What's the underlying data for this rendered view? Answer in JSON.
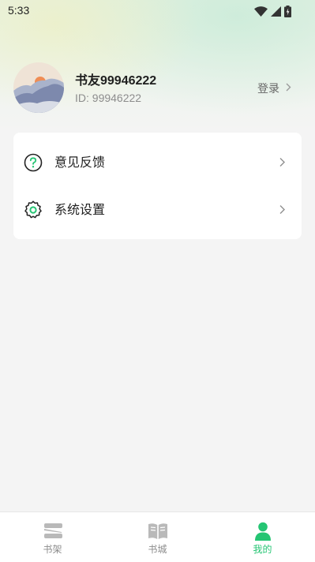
{
  "status_bar": {
    "time": "5:33",
    "icons": [
      "wifi-icon",
      "signal-icon",
      "battery-icon"
    ]
  },
  "profile": {
    "avatar": "mountain-sun-avatar",
    "name": "书友99946222",
    "id_label": "ID: 99946222",
    "login_label": "登录"
  },
  "menu": {
    "items": [
      {
        "label": "意见反馈",
        "icon": "question-circle-icon"
      },
      {
        "label": "系统设置",
        "icon": "settings-gear-icon"
      }
    ]
  },
  "bottom_nav": {
    "tabs": [
      {
        "label": "书架",
        "icon": "bookshelf-icon",
        "active": false
      },
      {
        "label": "书城",
        "icon": "open-book-icon",
        "active": false
      },
      {
        "label": "我的",
        "icon": "person-icon",
        "active": true
      }
    ]
  },
  "colors": {
    "accent": "#25c573",
    "page_background": "#f4f4f4",
    "card_background": "#ffffff",
    "inactive_icon": "#b9b9b9"
  }
}
